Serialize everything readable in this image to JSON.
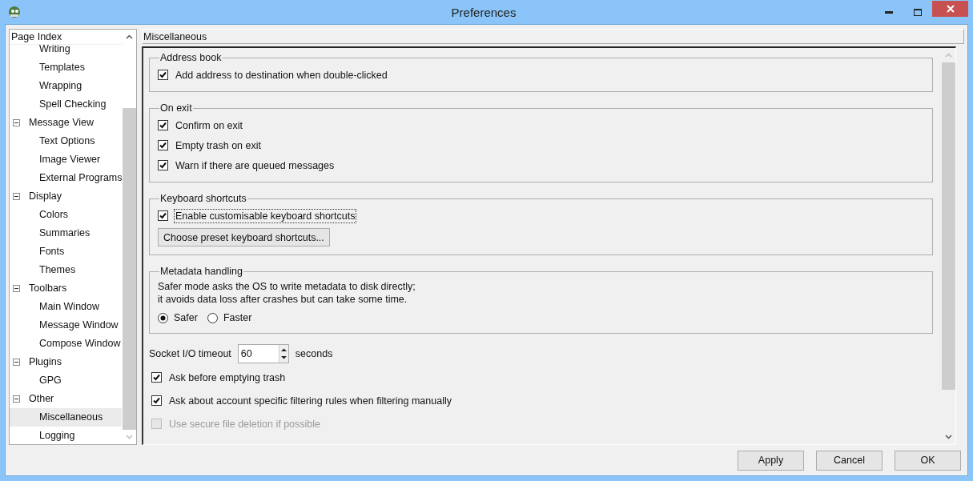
{
  "window": {
    "title": "Preferences"
  },
  "page_index": {
    "title": "Page Index",
    "items": [
      {
        "children": [
          {
            "label": "Writing",
            "selected": false
          },
          {
            "label": "Templates",
            "selected": false
          },
          {
            "label": "Wrapping",
            "selected": false
          },
          {
            "label": "Spell Checking",
            "selected": false
          }
        ]
      },
      {
        "label": "Message View",
        "expanded": true,
        "selected": false,
        "children": [
          {
            "label": "Text Options",
            "selected": false
          },
          {
            "label": "Image Viewer",
            "selected": false
          },
          {
            "label": "External Programs",
            "selected": false
          }
        ]
      },
      {
        "label": "Display",
        "expanded": true,
        "selected": false,
        "children": [
          {
            "label": "Colors",
            "selected": false
          },
          {
            "label": "Summaries",
            "selected": false
          },
          {
            "label": "Fonts",
            "selected": false
          },
          {
            "label": "Themes",
            "selected": false
          }
        ]
      },
      {
        "label": "Toolbars",
        "expanded": true,
        "selected": false,
        "children": [
          {
            "label": "Main Window",
            "selected": false
          },
          {
            "label": "Message Window",
            "selected": false
          },
          {
            "label": "Compose Window",
            "selected": false
          }
        ]
      },
      {
        "label": "Plugins",
        "expanded": true,
        "selected": false,
        "children": [
          {
            "label": "GPG",
            "selected": false
          }
        ]
      },
      {
        "label": "Other",
        "expanded": true,
        "selected": false,
        "children": [
          {
            "label": "Miscellaneous",
            "selected": true
          },
          {
            "label": "Logging",
            "selected": false
          }
        ]
      }
    ]
  },
  "page": {
    "title": "Miscellaneous",
    "items": [
      {
        "kind": "group",
        "title": "Address book",
        "items": [
          {
            "kind": "checkbox",
            "label": "Add address to destination when double-clicked",
            "checked": true,
            "focused": false,
            "disabled": false
          }
        ]
      },
      {
        "kind": "group",
        "title": "On exit",
        "items": [
          {
            "kind": "checkbox",
            "label": "Confirm on exit",
            "checked": true,
            "focused": false,
            "disabled": false
          },
          {
            "kind": "checkbox",
            "label": "Empty trash on exit",
            "checked": true,
            "focused": false,
            "disabled": false
          },
          {
            "kind": "checkbox",
            "label": "Warn if there are queued messages",
            "checked": true,
            "focused": false,
            "disabled": false
          }
        ]
      },
      {
        "kind": "group",
        "title": "Keyboard shortcuts",
        "items": [
          {
            "kind": "checkbox",
            "label": "Enable customisable keyboard shortcuts",
            "checked": true,
            "focused": true,
            "disabled": false
          },
          {
            "kind": "button",
            "label": "Choose preset keyboard shortcuts..."
          }
        ]
      },
      {
        "kind": "group",
        "title": "Metadata handling",
        "items": [
          {
            "kind": "text",
            "lines": [
              "Safer mode asks the OS to write metadata to disk directly;",
              "it avoids data loss after crashes but can take some time."
            ]
          },
          {
            "kind": "radios",
            "options": [
              {
                "label": "Safer",
                "selected": true
              },
              {
                "label": "Faster",
                "selected": false
              }
            ]
          }
        ]
      },
      {
        "kind": "spin",
        "label": "Socket I/O timeout",
        "value": "60",
        "unit": "seconds"
      },
      {
        "kind": "checkbox",
        "label": "Ask before emptying trash",
        "checked": true,
        "focused": false,
        "disabled": false
      },
      {
        "kind": "checkbox",
        "label": "Ask about account specific filtering rules when filtering manually",
        "checked": true,
        "focused": false,
        "disabled": false
      },
      {
        "kind": "checkbox",
        "label": "Use secure file deletion if possible",
        "checked": false,
        "focused": false,
        "disabled": true
      }
    ]
  },
  "buttons": [
    "Apply",
    "Cancel",
    "OK"
  ]
}
